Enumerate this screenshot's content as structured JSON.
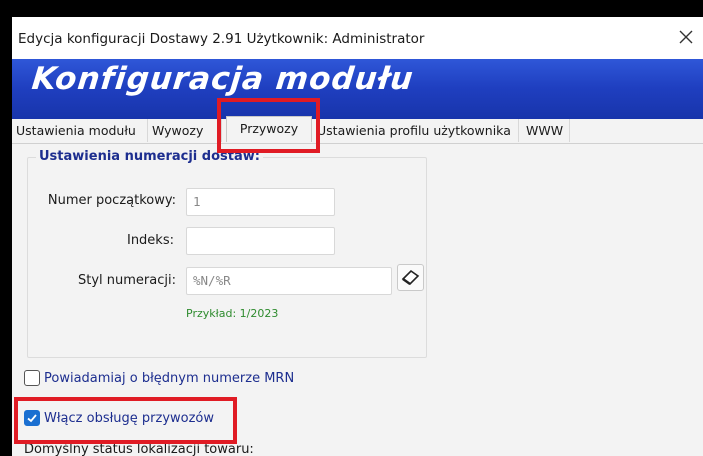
{
  "window": {
    "title": "Edycja konfiguracji Dostawy 2.91 Użytkownik: Administrator"
  },
  "banner": {
    "title": "Konfiguracja modułu"
  },
  "tabs": [
    {
      "label": "Ustawienia modułu",
      "active": false
    },
    {
      "label": "Wywozy",
      "active": false
    },
    {
      "label": "Przywozy",
      "active": true
    },
    {
      "label": "Ustawienia profilu użytkownika",
      "active": false
    },
    {
      "label": "WWW",
      "active": false
    }
  ],
  "numbering": {
    "group_title": "Ustawienia numeracji dostaw:",
    "start_number_label": "Numer początkowy:",
    "start_number_value": "1",
    "index_label": "Indeks:",
    "index_value": "",
    "style_label": "Styl numeracji:",
    "style_value": "%N/%R",
    "example": "Przykład: 1/2023"
  },
  "options": {
    "mrn_notify_label": "Powiadamiaj o błędnym numerze MRN",
    "mrn_notify_checked": false,
    "enable_imports_label": "Włącz obsługę przywozów",
    "enable_imports_checked": true
  },
  "bottom": {
    "default_status_label": "Domyślny status lokalizacji towaru:"
  },
  "colors": {
    "banner": "#1f3fc0",
    "highlight": "#e01b24",
    "checkbox_checked": "#1a6fd1",
    "example_text": "#2e8b2e",
    "label_blue": "#1d2e8f"
  }
}
